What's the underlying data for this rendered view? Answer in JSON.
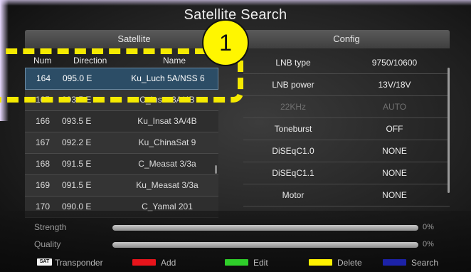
{
  "title": "Satellite Search",
  "satellite_panel": {
    "header": "Satellite",
    "columns": {
      "num": "Num",
      "direction": "Direction",
      "name": "Name"
    },
    "rows": [
      {
        "num": "164",
        "direction": "095.0 E",
        "name": "Ku_Luch 5A/NSS 6",
        "selected": true
      },
      {
        "num": "165",
        "direction": "093.5 E",
        "name": "C_Insat 3A/4B"
      },
      {
        "num": "166",
        "direction": "093.5 E",
        "name": "Ku_Insat 3A/4B"
      },
      {
        "num": "167",
        "direction": "092.2 E",
        "name": "Ku_ChinaSat 9"
      },
      {
        "num": "168",
        "direction": "091.5 E",
        "name": "C_Measat 3/3a"
      },
      {
        "num": "169",
        "direction": "091.5 E",
        "name": "Ku_Measat 3/3a"
      },
      {
        "num": "170",
        "direction": "090.0 E",
        "name": "C_Yamal 201"
      }
    ]
  },
  "config_panel": {
    "header": "Config",
    "rows": [
      {
        "key": "LNB type",
        "value": "9750/10600"
      },
      {
        "key": "LNB power",
        "value": "13V/18V"
      },
      {
        "key": "22KHz",
        "value": "AUTO",
        "disabled": true
      },
      {
        "key": "Toneburst",
        "value": "OFF"
      },
      {
        "key": "DiSEqC1.0",
        "value": "NONE"
      },
      {
        "key": "DiSEqC1.1",
        "value": "NONE"
      },
      {
        "key": "Motor",
        "value": "NONE"
      }
    ]
  },
  "signal": {
    "strength_label": "Strength",
    "strength_value": "0%",
    "strength_level": 0,
    "quality_label": "Quality",
    "quality_value": "0%",
    "quality_level": 0
  },
  "legend": {
    "transponder_key": "SAT",
    "transponder": "Transponder",
    "add": "Add",
    "edit": "Edit",
    "delete": "Delete",
    "search": "Search",
    "colors": {
      "add": "#e8141b",
      "edit": "#2fcf2a",
      "delete": "#fff200",
      "search": "#1c22a8"
    }
  },
  "annotation": {
    "badge": "1",
    "color": "#f5ea00"
  }
}
